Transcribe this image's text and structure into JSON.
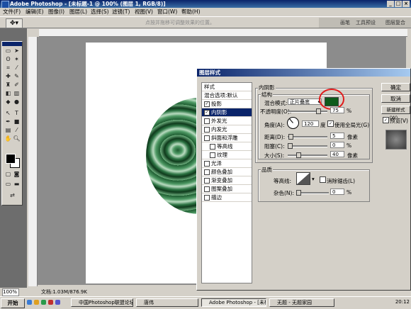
{
  "window": {
    "title": "Adobe Photoshop - [未标题-1 @ 100% (图层 1, RGB/8)]"
  },
  "menu": [
    "文件(F)",
    "编辑(E)",
    "图像(I)",
    "图层(L)",
    "选择(S)",
    "滤镜(T)",
    "视图(V)",
    "窗口(W)",
    "帮助(H)"
  ],
  "options_bar": {
    "hint": "点按并拖移可调整效果的位置。",
    "palette_tabs": [
      "画笔",
      "工具预设",
      "图层复合"
    ]
  },
  "status_bar": {
    "zoom": "100%",
    "doc_size": "文档:1.03M/876.9K"
  },
  "dialog": {
    "title": "图层样式",
    "styles": [
      {
        "label": "样式",
        "checked": null
      },
      {
        "label": "混合选项:默认",
        "checked": null
      },
      {
        "label": "投影",
        "checked": true
      },
      {
        "label": "内阴影",
        "checked": true
      },
      {
        "label": "外发光",
        "checked": false
      },
      {
        "label": "内发光",
        "checked": false
      },
      {
        "label": "斜面和浮雕",
        "checked": false
      },
      {
        "label": "等高线",
        "checked": false
      },
      {
        "label": "纹理",
        "checked": false
      },
      {
        "label": "光泽",
        "checked": false
      },
      {
        "label": "颜色叠加",
        "checked": false
      },
      {
        "label": "渐变叠加",
        "checked": false
      },
      {
        "label": "图案叠加",
        "checked": false
      },
      {
        "label": "描边",
        "checked": false
      }
    ],
    "section_title": "内阴影",
    "structure": {
      "title": "结构",
      "blend_mode_label": "混合模式:",
      "blend_mode_value": "正片叠底",
      "opacity_label": "不透明度(O):",
      "opacity_value": "75",
      "angle_label": "角度(A):",
      "angle_value": "120",
      "degree_unit": "度",
      "global_light_label": "使用全局光(G)",
      "distance_label": "距离(D):",
      "distance_value": "5",
      "choke_label": "阻塞(C):",
      "choke_value": "0",
      "size_label": "大小(S):",
      "size_value": "40",
      "px_unit": "像素",
      "pct_unit": "%"
    },
    "quality": {
      "title": "品质",
      "contour_label": "等高线:",
      "antialias_label": "消除锯齿(L)",
      "noise_label": "杂色(N):",
      "noise_value": "0",
      "pct_unit": "%"
    },
    "buttons": {
      "ok": "确定",
      "cancel": "取消",
      "new_style": "新建样式(W)...",
      "preview": "预览(V)"
    },
    "shadow_color": "#0c5a1a",
    "annotation_color": "#e01b1b"
  },
  "taskbar": {
    "start": "开始",
    "tasks": [
      "中国Photoshop联盟论坛...",
      "唐伟",
      "Adobe Photoshop - [未标...",
      "无题 - 无题家园"
    ],
    "clock": "20:12"
  }
}
